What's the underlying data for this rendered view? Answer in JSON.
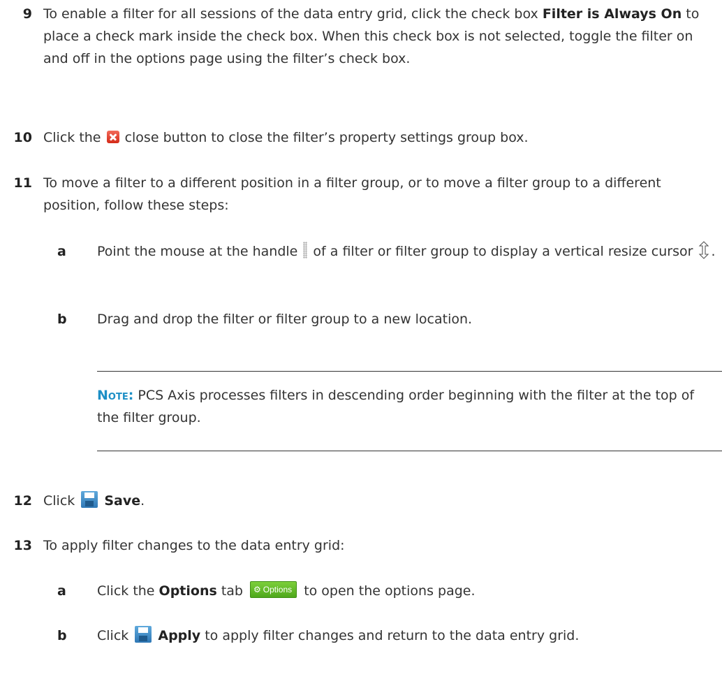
{
  "steps": {
    "s9": {
      "number": "9",
      "t1": "To enable a filter for all sessions of the data entry grid, click the check box ",
      "b1": "Filter is Always On",
      "t2": " to place a check mark inside the check box. When this check box is not selected, toggle the filter on and off in the options page using the filter’s check box."
    },
    "s10": {
      "number": "10",
      "t1": "Click the ",
      "t2": " close button to close the filter’s property settings group box."
    },
    "s11": {
      "number": "11",
      "t1": "To move a filter to a different position in a filter group, or to move a filter group to a different position, follow these steps:",
      "a": {
        "letter": "a",
        "t1": "Point the mouse at the handle ",
        "t2": " of a filter or filter group to display a vertical resize cursor ",
        "t3": "."
      },
      "b": {
        "letter": "b",
        "t1": "Drag and drop the filter or filter group to a new location."
      }
    },
    "note": {
      "label": "Note:",
      "text": "PCS Axis processes filters in descending order beginning with the filter at the top of the filter group."
    },
    "s12": {
      "number": "12",
      "t1": "Click ",
      "b1": "Save",
      "t2": "."
    },
    "s13": {
      "number": "13",
      "t1": "To apply filter changes to the data entry grid:",
      "a": {
        "letter": "a",
        "t1": "Click the ",
        "b1": "Options",
        "t2": " tab ",
        "tab_label": "Options",
        "t3": " to open the options page."
      },
      "b": {
        "letter": "b",
        "t1": "Click ",
        "b1": "Apply",
        "t2": " to apply filter changes and return to the data entry grid."
      }
    }
  },
  "icons": {
    "close": "close-icon",
    "handle": "drag-handle-icon",
    "cursor": "vertical-resize-cursor-icon",
    "save": "save-icon",
    "options_tab": "gear-icon",
    "apply": "save-icon"
  },
  "colors": {
    "note_label": "#1d8fc6",
    "close_icon": "#d42a17",
    "save_icon": "#2f78b6",
    "options_tab": "#4ea81c"
  }
}
